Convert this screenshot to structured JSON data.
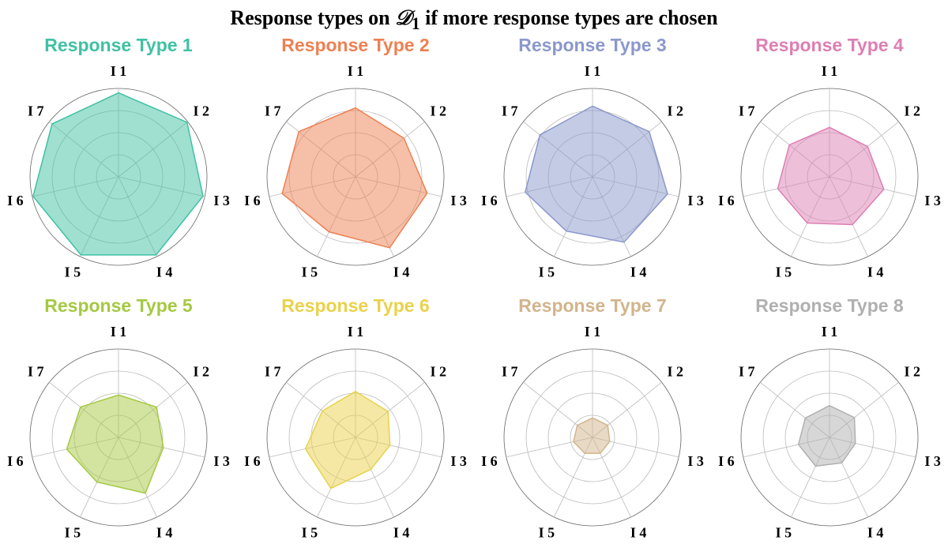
{
  "title_prefix": "Response types on ",
  "title_script": "𝒟",
  "title_sub": "1",
  "title_suffix": " if more response types are chosen",
  "axis_labels": [
    "I 1",
    "I 2",
    "I 3",
    "I 4",
    "I 5",
    "I 6",
    "I 7"
  ],
  "max_radius": 1.0,
  "rings": [
    0.25,
    0.5,
    0.75,
    1.0
  ],
  "colors": {
    "t1": "#3fc1a4",
    "t2": "#ee8052",
    "t3": "#8a98cc",
    "t4": "#dd7fb3",
    "t5": "#a5c942",
    "t6": "#e9d24a",
    "t7": "#d2b48c",
    "t8": "#b0b0b0"
  },
  "chart_data": [
    {
      "type": "radar",
      "name": "Response Type 1",
      "color_key": "t1",
      "categories": [
        "I 1",
        "I 2",
        "I 3",
        "I 4",
        "I 5",
        "I 6",
        "I 7"
      ],
      "values": [
        0.95,
        0.99,
        0.98,
        0.98,
        0.98,
        0.99,
        0.96
      ]
    },
    {
      "type": "radar",
      "name": "Response Type 2",
      "color_key": "t2",
      "categories": [
        "I 1",
        "I 2",
        "I 3",
        "I 4",
        "I 5",
        "I 6",
        "I 7"
      ],
      "values": [
        0.78,
        0.7,
        0.83,
        0.89,
        0.69,
        0.85,
        0.82
      ]
    },
    {
      "type": "radar",
      "name": "Response Type 3",
      "color_key": "t3",
      "categories": [
        "I 1",
        "I 2",
        "I 3",
        "I 4",
        "I 5",
        "I 6",
        "I 7"
      ],
      "values": [
        0.8,
        0.82,
        0.87,
        0.82,
        0.68,
        0.78,
        0.76
      ]
    },
    {
      "type": "radar",
      "name": "Response Type 4",
      "color_key": "t4",
      "categories": [
        "I 1",
        "I 2",
        "I 3",
        "I 4",
        "I 5",
        "I 6",
        "I 7"
      ],
      "values": [
        0.56,
        0.55,
        0.63,
        0.6,
        0.58,
        0.6,
        0.58
      ]
    },
    {
      "type": "radar",
      "name": "Response Type 5",
      "color_key": "t5",
      "categories": [
        "I 1",
        "I 2",
        "I 3",
        "I 4",
        "I 5",
        "I 6",
        "I 7"
      ],
      "values": [
        0.48,
        0.55,
        0.52,
        0.7,
        0.56,
        0.6,
        0.55
      ]
    },
    {
      "type": "radar",
      "name": "Response Type 6",
      "color_key": "t6",
      "categories": [
        "I 1",
        "I 2",
        "I 3",
        "I 4",
        "I 5",
        "I 6",
        "I 7"
      ],
      "values": [
        0.52,
        0.47,
        0.4,
        0.4,
        0.64,
        0.58,
        0.48
      ]
    },
    {
      "type": "radar",
      "name": "Response Type 7",
      "color_key": "t7",
      "categories": [
        "I 1",
        "I 2",
        "I 3",
        "I 4",
        "I 5",
        "I 6",
        "I 7"
      ],
      "values": [
        0.22,
        0.22,
        0.2,
        0.2,
        0.2,
        0.22,
        0.22
      ]
    },
    {
      "type": "radar",
      "name": "Response Type 8",
      "color_key": "t8",
      "categories": [
        "I 1",
        "I 2",
        "I 3",
        "I 4",
        "I 5",
        "I 6",
        "I 7"
      ],
      "values": [
        0.36,
        0.36,
        0.3,
        0.32,
        0.36,
        0.36,
        0.35
      ]
    }
  ]
}
